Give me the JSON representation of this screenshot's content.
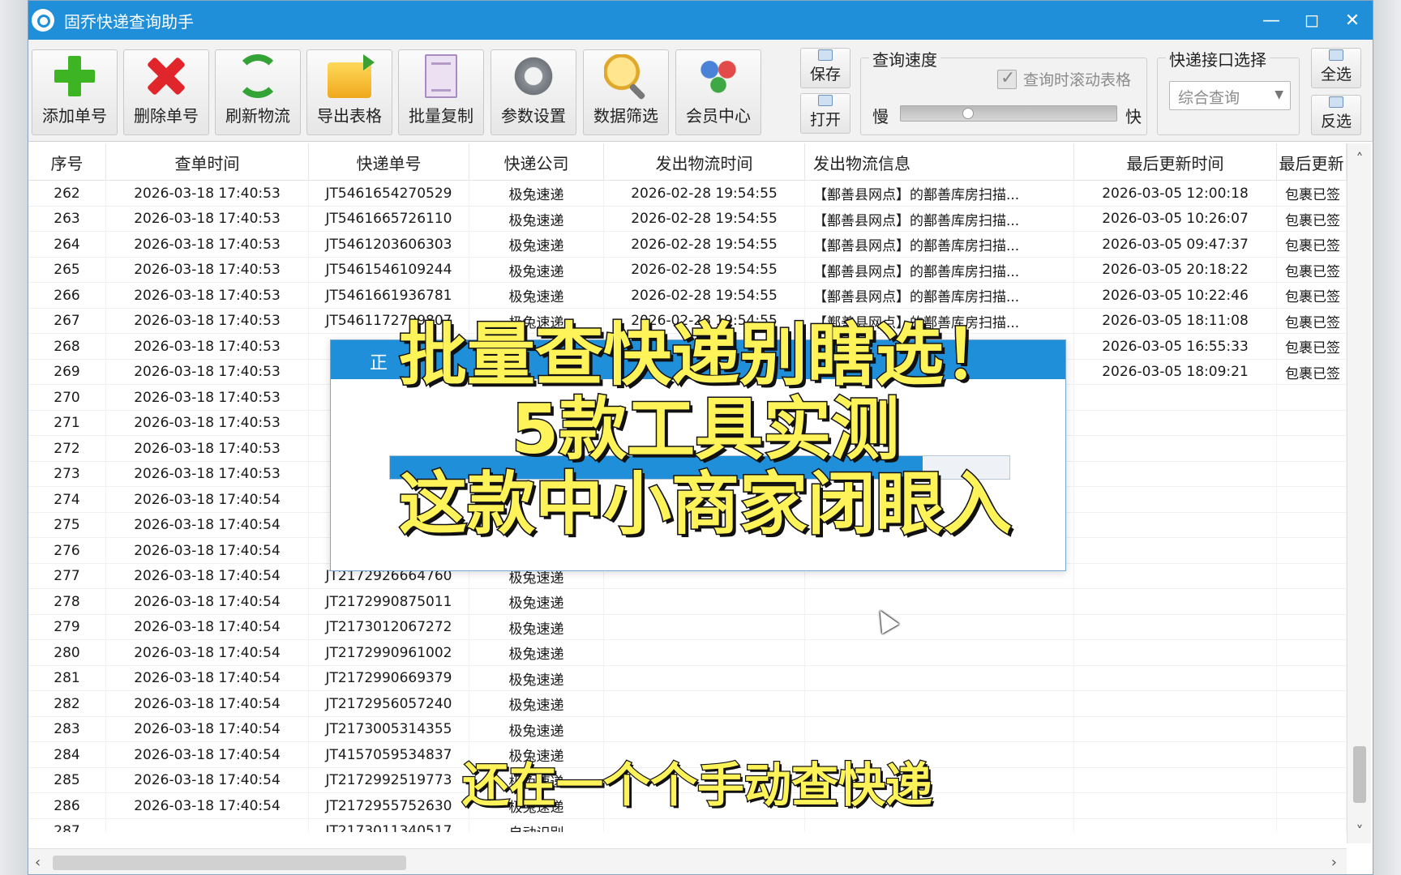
{
  "window": {
    "title": "固乔快递查询助手",
    "controls": {
      "minimize": "—",
      "maximize": "◻",
      "close": "✕"
    }
  },
  "toolbar": {
    "buttons": [
      {
        "label": "添加单号",
        "icon": "add-plus-icon"
      },
      {
        "label": "删除单号",
        "icon": "delete-x-icon"
      },
      {
        "label": "刷新物流",
        "icon": "refresh-icon"
      },
      {
        "label": "导出表格",
        "icon": "export-folder-icon"
      },
      {
        "label": "批量复制",
        "icon": "copy-documents-icon"
      },
      {
        "label": "参数设置",
        "icon": "gear-icon"
      },
      {
        "label": "数据筛选",
        "icon": "filter-search-icon"
      },
      {
        "label": "会员中心",
        "icon": "users-icon"
      }
    ],
    "save_label": "保存",
    "open_label": "打开",
    "speed": {
      "title": "查询速度",
      "scroll_checkbox_label": "查询时滚动表格",
      "slow_label": "慢",
      "fast_label": "快",
      "value": 0.3
    },
    "api": {
      "title": "快递接口选择",
      "selected": "综合查询"
    },
    "select_all_label": "全选",
    "invert_label": "反选"
  },
  "table": {
    "headers": [
      "序号",
      "查单时间",
      "快递单号",
      "快递公司",
      "发出物流时间",
      "发出物流信息",
      "最后更新时间",
      "最后更新"
    ],
    "rows": [
      [
        "262",
        "2026-03-18 17:40:53",
        "JT5461654270529",
        "极兔速递",
        "2026-02-28 19:54:55",
        "【鄯善县网点】的鄯善库房扫描...",
        "2026-03-05 12:00:18",
        "包裹已签"
      ],
      [
        "263",
        "2026-03-18 17:40:53",
        "JT5461665726110",
        "极兔速递",
        "2026-02-28 19:54:55",
        "【鄯善县网点】的鄯善库房扫描...",
        "2026-03-05 10:26:07",
        "包裹已签"
      ],
      [
        "264",
        "2026-03-18 17:40:53",
        "JT5461203606303",
        "极兔速递",
        "2026-02-28 19:54:55",
        "【鄯善县网点】的鄯善库房扫描...",
        "2026-03-05 09:47:37",
        "包裹已签"
      ],
      [
        "265",
        "2026-03-18 17:40:53",
        "JT5461546109244",
        "极兔速递",
        "2026-02-28 19:54:55",
        "【鄯善县网点】的鄯善库房扫描...",
        "2026-03-05 20:18:22",
        "包裹已签"
      ],
      [
        "266",
        "2026-03-18 17:40:53",
        "JT5461661936781",
        "极兔速递",
        "2026-02-28 19:54:55",
        "【鄯善县网点】的鄯善库房扫描...",
        "2026-03-05 10:22:46",
        "包裹已签"
      ],
      [
        "267",
        "2026-03-18 17:40:53",
        "JT5461172799807",
        "极兔速递",
        "2026-02-28 19:54:55",
        "【鄯善县网点】的鄯善库房扫描...",
        "2026-03-05 18:11:08",
        "包裹已签"
      ],
      [
        "268",
        "2026-03-18 17:40:53",
        "",
        "",
        "",
        "",
        "2026-03-05 16:55:33",
        "包裹已签"
      ],
      [
        "269",
        "2026-03-18 17:40:53",
        "",
        "",
        "",
        "",
        "2026-03-05 18:09:21",
        "包裹已签"
      ],
      [
        "270",
        "2026-03-18 17:40:53",
        "",
        "",
        "",
        "",
        "",
        ""
      ],
      [
        "271",
        "2026-03-18 17:40:53",
        "",
        "",
        "",
        "",
        "",
        ""
      ],
      [
        "272",
        "2026-03-18 17:40:53",
        "",
        "",
        "",
        "",
        "",
        ""
      ],
      [
        "273",
        "2026-03-18 17:40:53",
        "",
        "",
        "",
        "",
        "",
        ""
      ],
      [
        "274",
        "2026-03-18 17:40:54",
        "",
        "",
        "",
        "",
        "",
        ""
      ],
      [
        "275",
        "2026-03-18 17:40:54",
        "",
        "",
        "",
        "",
        "",
        ""
      ],
      [
        "276",
        "2026-03-18 17:40:54",
        "",
        "",
        "",
        "",
        "",
        ""
      ],
      [
        "277",
        "2026-03-18 17:40:54",
        "JT2172926664760",
        "极兔速递",
        "",
        "",
        "",
        ""
      ],
      [
        "278",
        "2026-03-18 17:40:54",
        "JT2172990875011",
        "极兔速递",
        "",
        "",
        "",
        ""
      ],
      [
        "279",
        "2026-03-18 17:40:54",
        "JT2173012067272",
        "极兔速递",
        "",
        "",
        "",
        ""
      ],
      [
        "280",
        "2026-03-18 17:40:54",
        "JT2172990961002",
        "极兔速递",
        "",
        "",
        "",
        ""
      ],
      [
        "281",
        "2026-03-18 17:40:54",
        "JT2172990669379",
        "极兔速递",
        "",
        "",
        "",
        ""
      ],
      [
        "282",
        "2026-03-18 17:40:54",
        "JT2172956057240",
        "极兔速递",
        "",
        "",
        "",
        ""
      ],
      [
        "283",
        "2026-03-18 17:40:54",
        "JT2173005314355",
        "极兔速递",
        "",
        "",
        "",
        ""
      ],
      [
        "284",
        "2026-03-18 17:40:54",
        "JT4157059534837",
        "极兔速递",
        "",
        "",
        "",
        ""
      ],
      [
        "285",
        "2026-03-18 17:40:54",
        "JT2172992519773",
        "极兔速递",
        "",
        "",
        "",
        ""
      ],
      [
        "286",
        "2026-03-18 17:40:54",
        "JT2172955752630",
        "极兔速递",
        "",
        "",
        "",
        ""
      ],
      [
        "287",
        "",
        "JT2173011340517",
        "自动识别",
        "",
        "",
        "",
        ""
      ]
    ]
  },
  "dialog": {
    "title": "正",
    "progress": 0.86
  },
  "overlay": {
    "line1": "批量查快递别瞎选！",
    "line2": "5款工具实测",
    "line3": "这款中小商家闭眼入"
  },
  "caption": "还在一个个手动查快递",
  "scrollbar": {
    "up": "˄",
    "down": "˅",
    "left": "‹",
    "right": "›"
  },
  "colors": {
    "accent": "#1e8fd8",
    "overlay_text": "#fff35a"
  }
}
